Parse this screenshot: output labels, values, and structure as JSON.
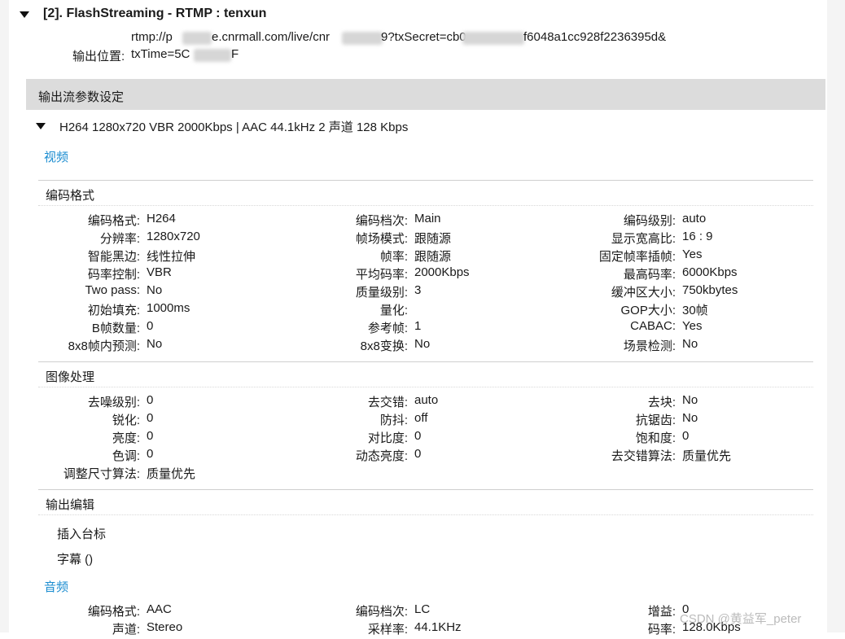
{
  "header": {
    "title": "[2]. FlashStreaming - RTMP : tenxun",
    "output_label": "输出位置:",
    "url_line1_a": "rtmp://p",
    "url_line1_b": "e.cnrmall.com/live/cnr",
    "url_line1_c": "9?txSecret=cb0",
    "url_line1_d": "f6048a1cc928f2236395d&",
    "url_line2_a": "txTime=5C",
    "url_line2_b": "F"
  },
  "params": {
    "section_title": "输出流参数设定",
    "profile_summary": "H264 1280x720 VBR 2000Kbps | AAC 44.1kHz 2 声道 128 Kbps",
    "video_link": "视频",
    "audio_link": "音频"
  },
  "encoding": {
    "title": "编码格式",
    "rows": [
      [
        [
          "编码格式:",
          "H264"
        ],
        [
          "编码档次:",
          "Main"
        ],
        [
          "编码级别:",
          "auto"
        ]
      ],
      [
        [
          "分辨率:",
          "1280x720"
        ],
        [
          "帧场模式:",
          "跟随源"
        ],
        [
          "显示宽高比:",
          "16 : 9"
        ]
      ],
      [
        [
          "智能黑边:",
          "线性拉伸"
        ],
        [
          "帧率:",
          "跟随源"
        ],
        [
          "固定帧率插帧:",
          "Yes"
        ]
      ],
      [
        [
          "码率控制:",
          "VBR"
        ],
        [
          "平均码率:",
          "2000Kbps"
        ],
        [
          "最高码率:",
          "6000Kbps"
        ]
      ],
      [
        [
          "Two pass:",
          "No"
        ],
        [
          "质量级别:",
          "3"
        ],
        [
          "缓冲区大小:",
          "750kbytes"
        ]
      ],
      [
        [
          "初始填充:",
          "1000ms"
        ],
        [
          "量化:",
          ""
        ],
        [
          "GOP大小:",
          "30帧"
        ]
      ],
      [
        [
          "B帧数量:",
          "0"
        ],
        [
          "参考帧:",
          "1"
        ],
        [
          "CABAC:",
          "Yes"
        ]
      ],
      [
        [
          "8x8帧内预测:",
          "No"
        ],
        [
          "8x8变换:",
          "No"
        ],
        [
          "场景检测:",
          "No"
        ]
      ]
    ]
  },
  "image_processing": {
    "title": "图像处理",
    "rows": [
      [
        [
          "去噪级别:",
          "0"
        ],
        [
          "去交错:",
          "auto"
        ],
        [
          "去块:",
          "No"
        ]
      ],
      [
        [
          "锐化:",
          "0"
        ],
        [
          "防抖:",
          "off"
        ],
        [
          "抗锯齿:",
          "No"
        ]
      ],
      [
        [
          "亮度:",
          "0"
        ],
        [
          "对比度:",
          "0"
        ],
        [
          "饱和度:",
          "0"
        ]
      ],
      [
        [
          "色调:",
          "0"
        ],
        [
          "动态亮度:",
          "0"
        ],
        [
          "去交错算法:",
          "质量优先"
        ]
      ],
      [
        [
          "调整尺寸算法:",
          "质量优先"
        ],
        [
          "",
          ""
        ],
        [
          "",
          ""
        ]
      ]
    ]
  },
  "output_edit": {
    "title": "输出编辑",
    "insert_logo": "插入台标",
    "subtitle": "字幕 ()"
  },
  "audio": {
    "rows": [
      [
        [
          "编码格式:",
          "AAC"
        ],
        [
          "编码档次:",
          "LC"
        ],
        [
          "增益:",
          "0"
        ]
      ],
      [
        [
          "声道:",
          "Stereo"
        ],
        [
          "采样率:",
          "44.1KHz"
        ],
        [
          "码率:",
          "128.0Kbps"
        ]
      ]
    ]
  },
  "watermark": "CSDN @黄益军_peter"
}
